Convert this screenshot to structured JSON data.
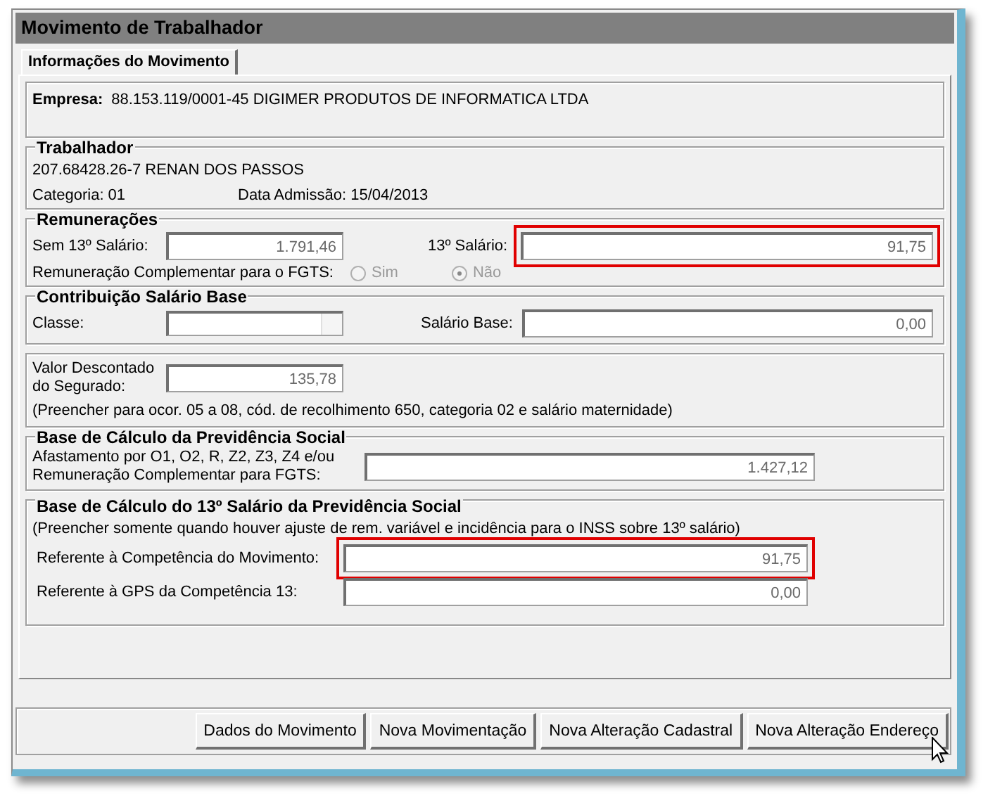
{
  "window": {
    "title": "Movimento de Trabalhador"
  },
  "tabs": [
    {
      "label": "Informações do Movimento",
      "selected": true
    }
  ],
  "empresa": {
    "label": "Empresa:",
    "value": "88.153.119/0001-45  DIGIMER PRODUTOS DE INFORMATICA LTDA"
  },
  "trabalhador": {
    "title": "Trabalhador",
    "worker": "207.68428.26-7 RENAN DOS PASSOS",
    "categoria": "Categoria: 01",
    "admissao": "Data Admissão: 15/04/2013"
  },
  "remuneracoes": {
    "title": "Remunerações",
    "fields": [
      {
        "label": "Sem 13º Salário:",
        "value": "1.791,46",
        "disabled": true,
        "highlighted": false
      },
      {
        "label": "13º Salário:",
        "value": "91,75",
        "disabled": true,
        "highlighted": true
      }
    ],
    "fgts": {
      "label": "Remuneração Complementar para o FGTS:",
      "options": [
        {
          "label": "Sim",
          "selected": false,
          "disabled": true
        },
        {
          "label": "Não",
          "selected": true,
          "disabled": true
        }
      ]
    }
  },
  "contribuicao": {
    "title": "Contribuição Salário Base",
    "classe": {
      "label": "Classe:",
      "disabled": true
    },
    "salario_base": {
      "label": "Salário Base:",
      "value": "0,00",
      "disabled": true,
      "highlighted": false
    }
  },
  "valor_descontado": {
    "field": {
      "label": "Valor Descontado do Segurado:",
      "value": "135,78",
      "disabled": true,
      "highlighted": false
    },
    "note": "(Preencher para ocor. 05 a 08, cód. de recolhimento 650, categoria 02 e salário maternidade)"
  },
  "base_calculo": {
    "title": "Base de Cálculo da Previdência Social",
    "field": {
      "label": "Afastamento por O1, O2, R, Z2, Z3, Z4 e/ou Remuneração Complementar para FGTS:",
      "value": "1.427,12",
      "disabled": true,
      "highlighted": false
    }
  },
  "base_13": {
    "title": "Base de Cálculo do 13º Salário da Previdência Social",
    "note": "(Preencher somente quando houver ajuste de rem. variável e incidência para o INSS sobre 13º salário)",
    "fields": [
      {
        "label": "Referente à Competência do Movimento:",
        "value": "91,75",
        "disabled": true,
        "highlighted": true
      },
      {
        "label": "Referente à GPS da Competência 13:",
        "value": "0,00",
        "disabled": true,
        "highlighted": false
      }
    ]
  },
  "buttons": [
    "Dados do Movimento",
    "Nova Movimentação",
    "Nova Alteração Cadastral",
    "Nova Alteração Endereço"
  ]
}
